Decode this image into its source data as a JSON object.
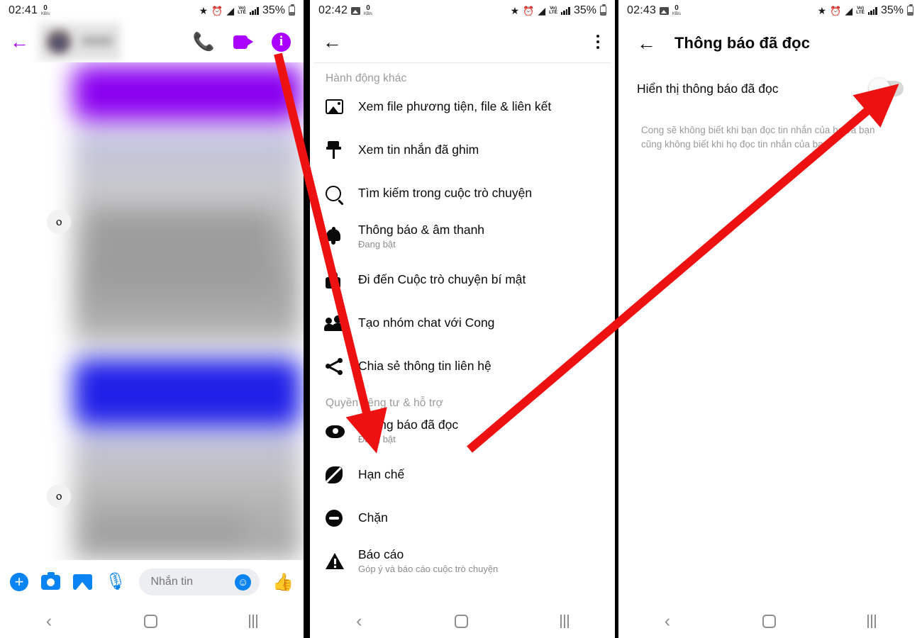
{
  "panels": {
    "chat": {
      "status_bar": {
        "clock": "02:41",
        "network_speed_value": "0",
        "network_speed_unit": "KB/s",
        "icons": [
          "star-icon",
          "alarm-icon",
          "wifi-icon",
          "volte-icon",
          "signal-bars-icon"
        ],
        "volte_top": "Vo)",
        "volte_bottom": "LTE",
        "battery_percent": "35%"
      },
      "appbar": {
        "back_label": "←",
        "contact_name_blurred": "",
        "call_icon": "phone-icon",
        "video_icon": "video-camera-icon",
        "info_icon": "info-icon",
        "info_label": "i"
      },
      "share_button_label": "ⲟ",
      "input_bar": {
        "plus_label": "+",
        "camera_icon": "camera-icon",
        "gallery_icon": "gallery-icon",
        "mic_label": "🎙",
        "message_placeholder": "Nhắn tin",
        "emoji_label": "☺",
        "like_label": "👍"
      }
    },
    "menu": {
      "status_bar": {
        "clock": "02:42",
        "network_speed_value": "0",
        "network_speed_unit": "KB/s",
        "volte_top": "Vo)",
        "volte_bottom": "LTE",
        "battery_percent": "35%"
      },
      "appbar": {
        "back_label": "←",
        "overflow_icon": "kebab-menu-icon"
      },
      "sections": [
        {
          "header": "Hành động khác",
          "items": [
            {
              "icon": "photo-icon",
              "title": "Xem file phương tiện, file & liên kết",
              "subtitle": ""
            },
            {
              "icon": "pin-icon",
              "title": "Xem tin nhắn đã ghim",
              "subtitle": ""
            },
            {
              "icon": "search-icon",
              "title": "Tìm kiếm trong cuộc trò chuyện",
              "subtitle": ""
            },
            {
              "icon": "bell-icon",
              "title": "Thông báo & âm thanh",
              "subtitle": "Đang bật"
            },
            {
              "icon": "lock-icon",
              "title": "Đi đến Cuộc trò chuyện bí mật",
              "subtitle": ""
            },
            {
              "icon": "people-icon",
              "title": "Tạo nhóm chat với Cong",
              "subtitle": ""
            },
            {
              "icon": "share-icon",
              "title": "Chia sẻ thông tin liên hệ",
              "subtitle": ""
            }
          ]
        },
        {
          "header": "Quyền riêng tư & hỗ trợ",
          "items": [
            {
              "icon": "eye-icon",
              "title": "Thông báo đã đọc",
              "subtitle": "Đang bật"
            },
            {
              "icon": "restrict-icon",
              "title": "Hạn chế",
              "subtitle": ""
            },
            {
              "icon": "block-icon",
              "title": "Chặn",
              "subtitle": ""
            },
            {
              "icon": "warning-icon",
              "title": "Báo cáo",
              "subtitle": "Góp ý và báo cáo cuộc trò chuyện"
            }
          ]
        }
      ]
    },
    "setting": {
      "status_bar": {
        "clock": "02:43",
        "network_speed_value": "0",
        "network_speed_unit": "KB/s",
        "volte_top": "Vo)",
        "volte_bottom": "LTE",
        "battery_percent": "35%"
      },
      "appbar": {
        "back_label": "←",
        "title": "Thông báo đã đọc"
      },
      "toggle_row": {
        "label": "Hiển thị thông báo đã đọc",
        "state": "off"
      },
      "description": "Cong sẽ không biết khi bạn đọc tin nhắn của họ và bạn cũng không biết khi họ đọc tin nhắn của bạn."
    }
  },
  "navbar": {
    "back_icon": "nav-back-icon",
    "home_icon": "nav-home-icon",
    "recents_icon": "nav-recents-icon"
  },
  "annotations": {
    "arrow_color": "#ee1111",
    "arrow_1": {
      "from": "info-icon (chat appbar)",
      "to": "Thông báo đã đọc (menu)"
    },
    "arrow_2": {
      "from": "Thông báo đã đọc (menu)",
      "to": "read-receipt-toggle (setting)"
    }
  },
  "colors": {
    "accent_purple": "#aa00ff",
    "accent_blue": "#0a84f2",
    "arrow_red": "#ee1111",
    "bubble_purple": "#8a00f0",
    "bubble_blue": "#2020e8"
  }
}
